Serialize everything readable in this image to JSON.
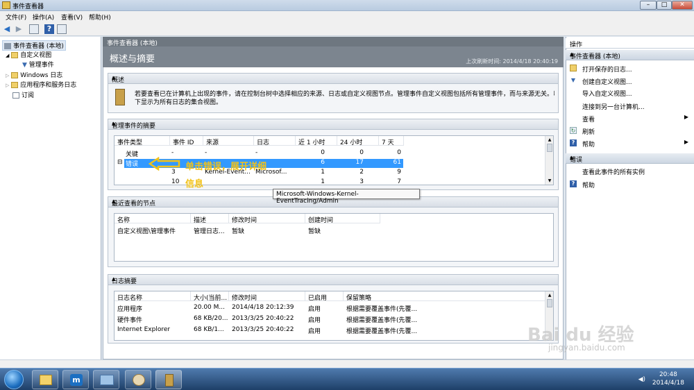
{
  "window": {
    "title": "事件查看器"
  },
  "menu": [
    "文件(F)",
    "操作(A)",
    "查看(V)",
    "帮助(H)"
  ],
  "tree": {
    "root": "事件查看器 (本地)",
    "custom_views": "自定义视图",
    "admin_events": "管理事件",
    "windows_logs": "Windows 日志",
    "app_service_logs": "应用程序和服务日志",
    "subscriptions": "订阅"
  },
  "center": {
    "header": "事件查看器 (本地)",
    "title": "概述与摘要",
    "last_refresh": "上次刷新时间: 2014/4/18 20:40:19",
    "overview": {
      "title": "概述",
      "text_line1": "若要查看已在计算机上出现的事件，请在控制台树中选择相应的来源、日志或自定义视图节点。管理事件自定义视图包括所有管理事件，而与来源无关。以",
      "text_line2": "下显示为所有日志的集合视图。"
    },
    "admin_summary": {
      "title": "管理事件的摘要",
      "columns": [
        "事件类型",
        "事件 ID",
        "来源",
        "日志",
        "近 1 小时",
        "24 小时",
        "7 天"
      ],
      "rows": [
        {
          "type": "关键",
          "id": "-",
          "source": "-",
          "log": "-",
          "h1": "0",
          "h24": "0",
          "d7": "0"
        },
        {
          "type": "错误",
          "id": "-",
          "source": "-",
          "log": "-",
          "h1": "6",
          "h24": "17",
          "d7": "61"
        },
        {
          "type": "",
          "id": "3",
          "source": "Kernel-Event...",
          "log": "Microsof...",
          "h1": "1",
          "h24": "2",
          "d7": "9"
        },
        {
          "type": "",
          "id": "10",
          "source": "",
          "log": "",
          "h1": "1",
          "h24": "3",
          "d7": "7"
        }
      ],
      "expand_icon": "⊟"
    },
    "tooltip": "Microsoft-Windows-Kernel-EventTracing/Admin",
    "recent_nodes": {
      "title": "最近查看的节点",
      "columns": [
        "名称",
        "描述",
        "修改时间",
        "创建时间"
      ],
      "rows": [
        {
          "name": "自定义视图\\管理事件",
          "desc": "管理日志...",
          "modified": "暂缺",
          "created": "暂缺"
        }
      ]
    },
    "log_summary": {
      "title": "日志摘要",
      "columns": [
        "日志名称",
        "大小(当前...",
        "修改时间",
        "已启用",
        "保留策略"
      ],
      "rows": [
        {
          "name": "应用程序",
          "size": "20.00 M...",
          "modified": "2014/4/18 20:12:39",
          "enabled": "启用",
          "policy": "根据需要覆盖事件(先覆..."
        },
        {
          "name": "硬件事件",
          "size": "68 KB/20...",
          "modified": "2013/3/25 20:40:22",
          "enabled": "启用",
          "policy": "根据需要覆盖事件(先覆..."
        },
        {
          "name": "Internet Explorer",
          "size": "68 KB/1...",
          "modified": "2013/3/25 20:40:22",
          "enabled": "启用",
          "policy": "根据需要覆盖事件(先覆..."
        }
      ]
    }
  },
  "annotation": {
    "line1": "单击错误，展开详细",
    "line2": "信息"
  },
  "actions": {
    "header": "操作",
    "group1_title": "事件查看器 (本地)",
    "group1": [
      {
        "label": "打开保存的日志...",
        "icon": "folder-icon"
      },
      {
        "label": "创建自定义视图...",
        "icon": "filter-icon"
      },
      {
        "label": "导入自定义视图...",
        "icon": "import-icon"
      },
      {
        "label": "连接到另一台计算机...",
        "icon": ""
      },
      {
        "label": "查看",
        "icon": "",
        "submenu": true
      },
      {
        "label": "刷新",
        "icon": "refresh-icon"
      },
      {
        "label": "帮助",
        "icon": "help-icon",
        "submenu": true
      }
    ],
    "group2_title": "错误",
    "group2": [
      {
        "label": "查看此事件的所有实例",
        "icon": ""
      },
      {
        "label": "帮助",
        "icon": "help-icon"
      }
    ]
  },
  "taskbar": {
    "time": "20:48",
    "date": "2014/4/18"
  },
  "watermark": {
    "main": "Bai du 经验",
    "sub": "jingyan.baidu.com"
  }
}
